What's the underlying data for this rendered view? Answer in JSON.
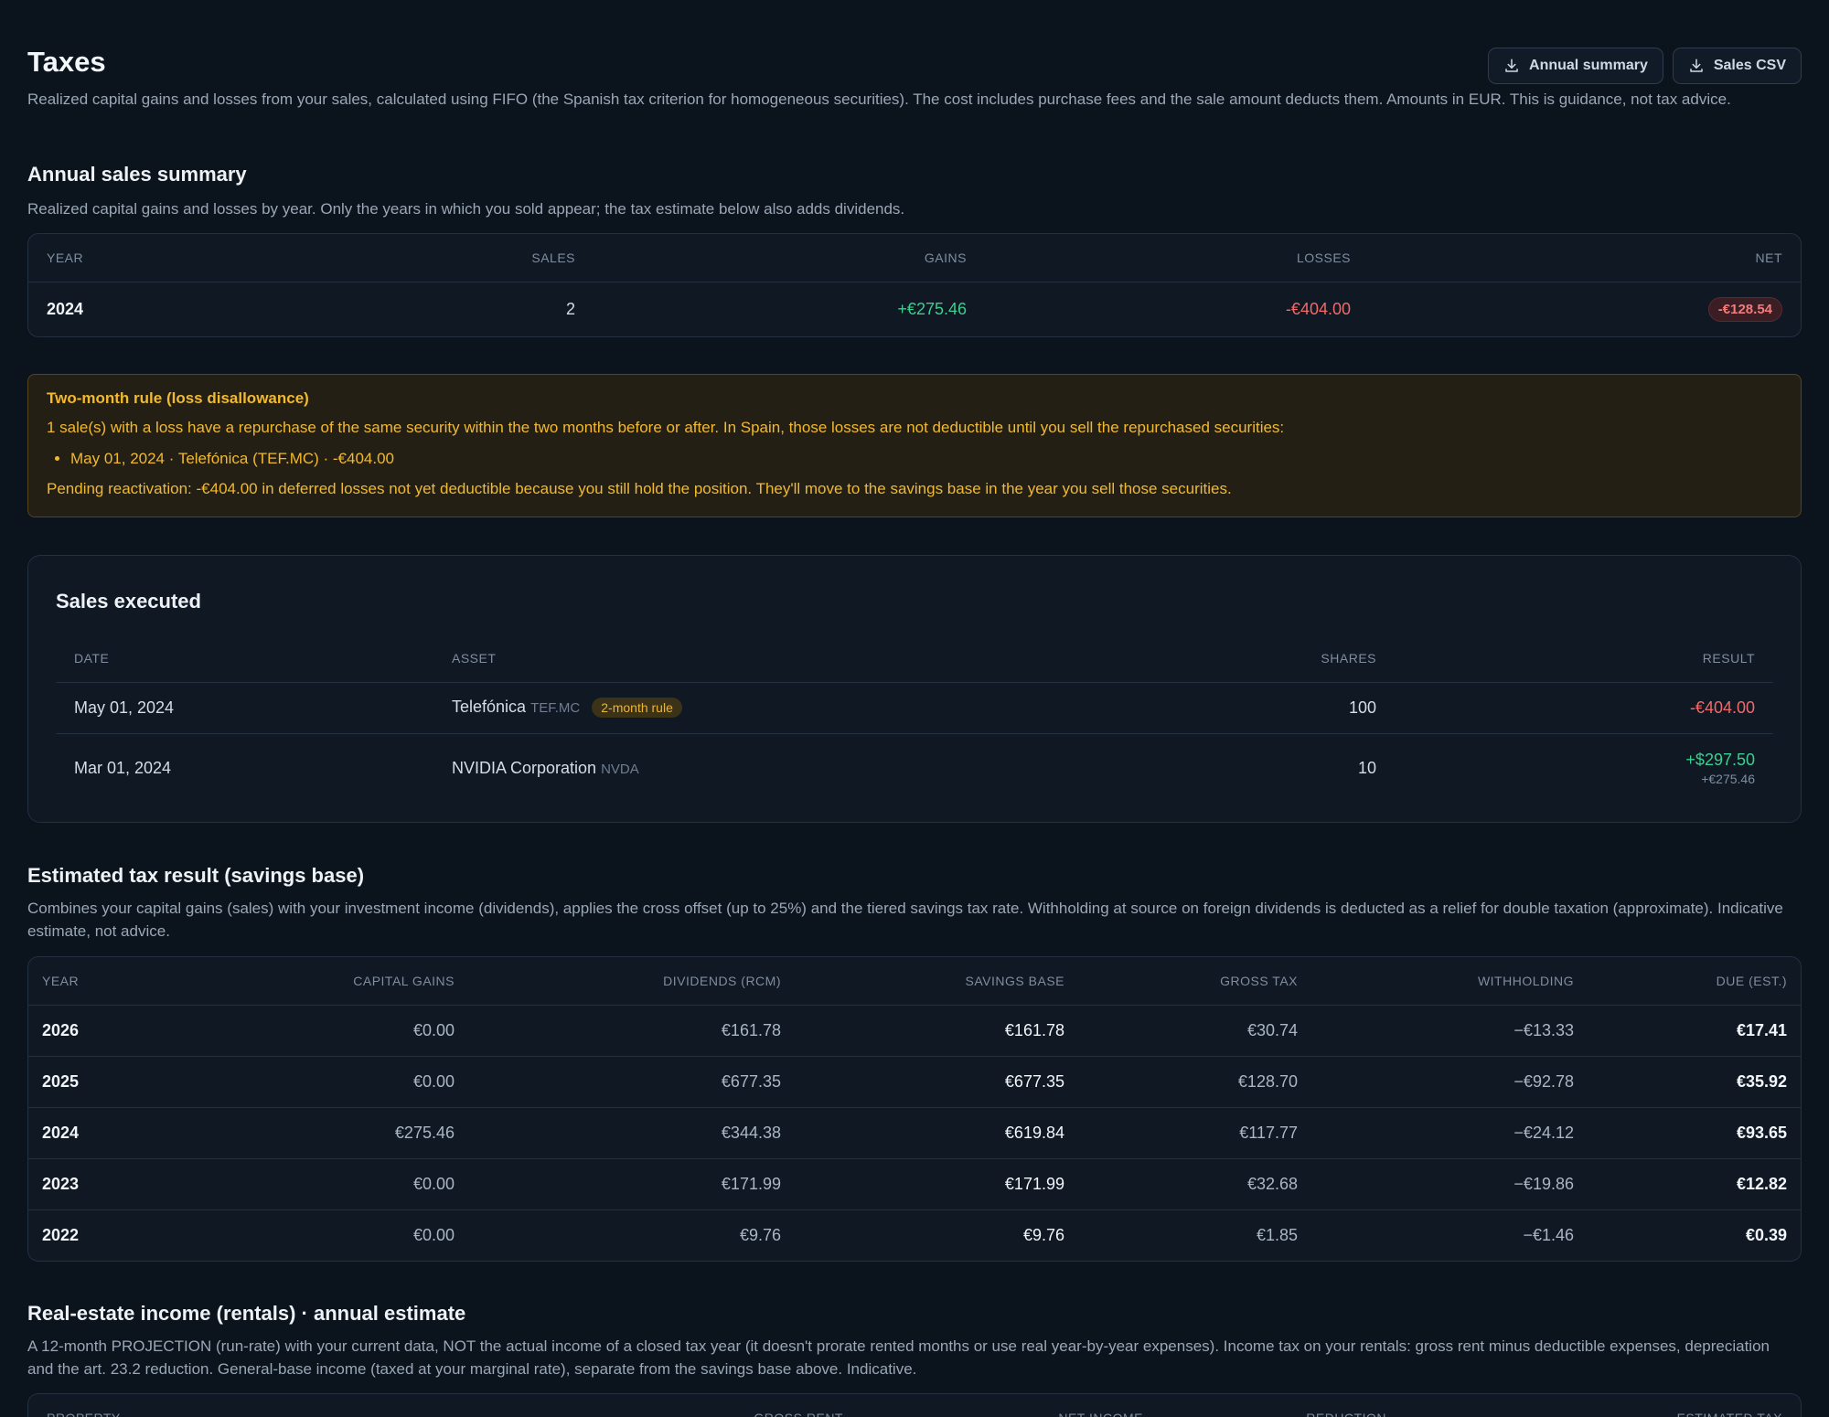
{
  "header": {
    "title": "Taxes",
    "subtitle": "Realized capital gains and losses from your sales, calculated using FIFO (the Spanish tax criterion for homogeneous securities). The cost includes purchase fees and the sale amount deducts them. Amounts in EUR. This is guidance, not tax advice.",
    "buttons": {
      "annual_summary": "Annual summary",
      "sales_csv": "Sales CSV"
    }
  },
  "annual": {
    "title": "Annual sales summary",
    "description": "Realized capital gains and losses by year. Only the years in which you sold appear; the tax estimate below also adds dividends.",
    "columns": [
      "Year",
      "Sales",
      "Gains",
      "Losses",
      "Net"
    ],
    "rows": [
      {
        "year": "2024",
        "sales": "2",
        "gains": "+€275.46",
        "losses": "-€404.00",
        "net": "-€128.54"
      }
    ]
  },
  "warning": {
    "title": "Two-month rule (loss disallowance)",
    "line1": "1 sale(s) with a loss have a repurchase of the same security within the two months before or after. In Spain, those losses are not deductible until you sell the repurchased securities:",
    "items": [
      "May 01, 2024 · Telefónica (TEF.MC) · -€404.00"
    ],
    "pending": "Pending reactivation: -€404.00 in deferred losses not yet deductible because you still hold the position. They'll move to the savings base in the year you sell those securities."
  },
  "sales": {
    "title": "Sales executed",
    "columns": [
      "Date",
      "Asset",
      "Shares",
      "Result"
    ],
    "rows": [
      {
        "date": "May 01, 2024",
        "asset": "Telefónica",
        "ticker": "TEF.MC",
        "badge": "2-month rule",
        "shares": "100",
        "result": "-€404.00",
        "result_eur": ""
      },
      {
        "date": "Mar 01, 2024",
        "asset": "NVIDIA Corporation",
        "ticker": "NVDA",
        "badge": "",
        "shares": "10",
        "result": "+$297.50",
        "result_eur": "+€275.46"
      }
    ]
  },
  "tax": {
    "title": "Estimated tax result (savings base)",
    "description": "Combines your capital gains (sales) with your investment income (dividends), applies the cross offset (up to 25%) and the tiered savings tax rate. Withholding at source on foreign dividends is deducted as a relief for double taxation (approximate). Indicative estimate, not advice.",
    "columns": [
      "Year",
      "Capital gains",
      "Dividends (RCM)",
      "Savings base",
      "Gross tax",
      "Withholding",
      "Due (est.)"
    ],
    "rows": [
      {
        "year": "2026",
        "capital_gains": "€0.00",
        "dividends": "€161.78",
        "savings_base": "€161.78",
        "gross_tax": "€30.74",
        "withholding": "−€13.33",
        "due": "€17.41"
      },
      {
        "year": "2025",
        "capital_gains": "€0.00",
        "dividends": "€677.35",
        "savings_base": "€677.35",
        "gross_tax": "€128.70",
        "withholding": "−€92.78",
        "due": "€35.92"
      },
      {
        "year": "2024",
        "capital_gains": "€275.46",
        "dividends": "€344.38",
        "savings_base": "€619.84",
        "gross_tax": "€117.77",
        "withholding": "−€24.12",
        "due": "€93.65"
      },
      {
        "year": "2023",
        "capital_gains": "€0.00",
        "dividends": "€171.99",
        "savings_base": "€171.99",
        "gross_tax": "€32.68",
        "withholding": "−€19.86",
        "due": "€12.82"
      },
      {
        "year": "2022",
        "capital_gains": "€0.00",
        "dividends": "€9.76",
        "savings_base": "€9.76",
        "gross_tax": "€1.85",
        "withholding": "−€1.46",
        "due": "€0.39"
      }
    ]
  },
  "real_estate": {
    "title": "Real-estate income (rentals) · annual estimate",
    "description": "A 12-month PROJECTION (run-rate) with your current data, NOT the actual income of a closed tax year (it doesn't prorate rented months or use real year-by-year expenses). Income tax on your rentals: gross rent minus deductible expenses, depreciation and the art. 23.2 reduction. General-base income (taxed at your marginal rate), separate from the savings base above. Indicative.",
    "columns": [
      "Property",
      "Gross rent",
      "Net income",
      "Reduction",
      "Estimated tax"
    ]
  },
  "icons": {
    "download": "download-icon"
  },
  "colors": {
    "gain": "#3ccf8e",
    "loss": "#f06a6a",
    "warning": "#f1b92f"
  }
}
